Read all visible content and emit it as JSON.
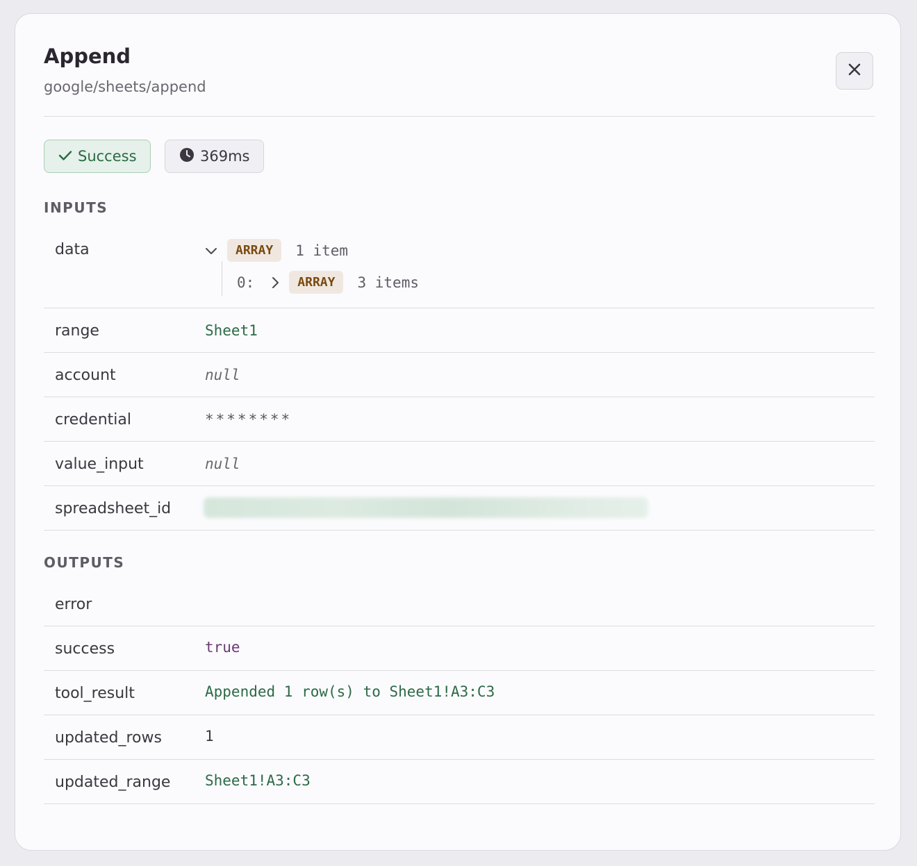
{
  "header": {
    "title": "Append",
    "subtitle": "google/sheets/append"
  },
  "status": {
    "success_label": "Success",
    "duration_label": "369ms",
    "success_color": "#2c6a46"
  },
  "inputs": {
    "section_label": "INPUTS",
    "data": {
      "key": "data",
      "type_tag": "ARRAY",
      "count_label": "1 item",
      "child_index": "0:",
      "child_type_tag": "ARRAY",
      "child_count_label": "3 items"
    },
    "range": {
      "key": "range",
      "value": "Sheet1"
    },
    "account": {
      "key": "account",
      "value": "null"
    },
    "credential": {
      "key": "credential",
      "value": "********"
    },
    "value_input": {
      "key": "value_input",
      "value": "null"
    },
    "spreadsheet_id": {
      "key": "spreadsheet_id"
    }
  },
  "outputs": {
    "section_label": "OUTPUTS",
    "error": {
      "key": "error"
    },
    "success": {
      "key": "success",
      "value": "true"
    },
    "tool_result": {
      "key": "tool_result",
      "value": "Appended 1 row(s) to Sheet1!A3:C3"
    },
    "updated_rows": {
      "key": "updated_rows",
      "value": "1"
    },
    "updated_range": {
      "key": "updated_range",
      "value": "Sheet1!A3:C3"
    }
  },
  "icons": {
    "close": "close-icon",
    "check": "check-icon",
    "clock": "clock-icon",
    "expand": "chevron-down-icon",
    "collapse": "chevron-right-icon"
  }
}
